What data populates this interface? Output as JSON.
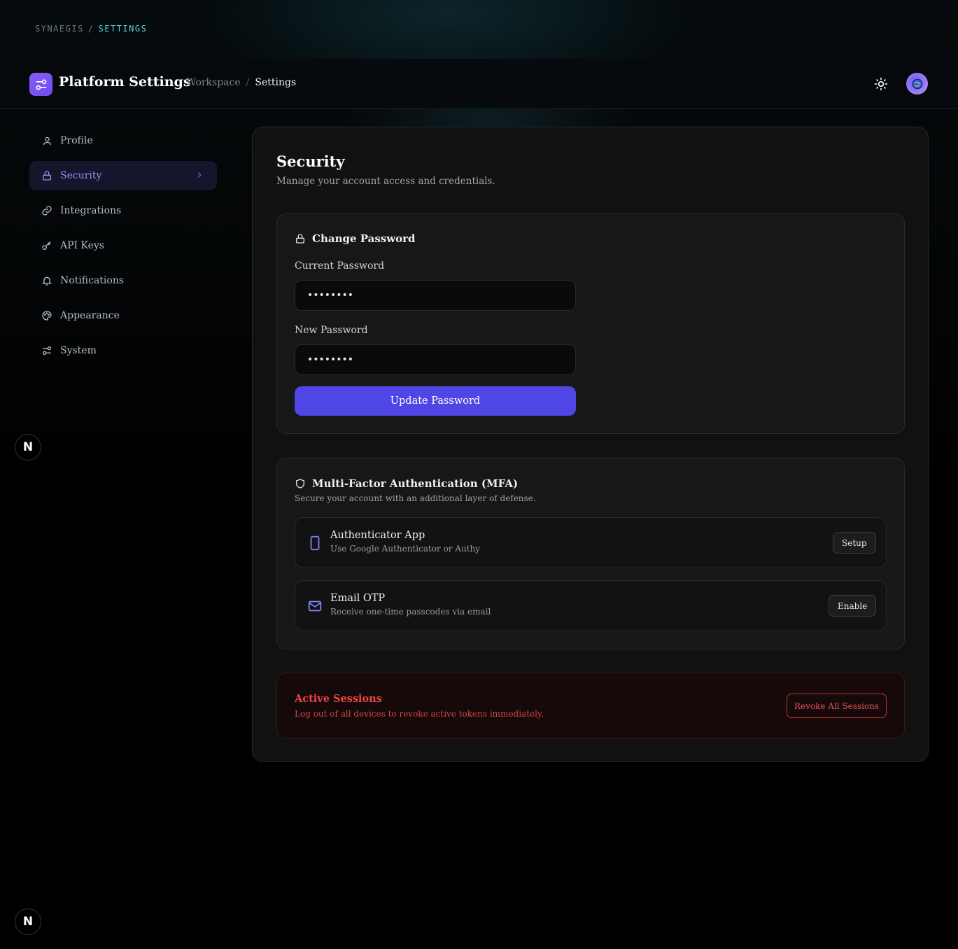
{
  "top_breadcrumb": {
    "root": "SYNAEGIS",
    "separator": "/",
    "current": "SETTINGS"
  },
  "header": {
    "title": "Platform Settings",
    "breadcrumb": {
      "parent": "Workspace",
      "separator": "/",
      "current": "Settings"
    },
    "theme_icon": "sun-icon",
    "avatar_icon": "globe-avatar"
  },
  "sidebar": {
    "items": [
      {
        "label": "Profile",
        "icon": "user-icon"
      },
      {
        "label": "Security",
        "icon": "lock-icon",
        "active": true
      },
      {
        "label": "Integrations",
        "icon": "link-icon"
      },
      {
        "label": "API Keys",
        "icon": "key-icon"
      },
      {
        "label": "Notifications",
        "icon": "bell-icon"
      },
      {
        "label": "Appearance",
        "icon": "palette-icon"
      },
      {
        "label": "System",
        "icon": "sliders-icon"
      }
    ]
  },
  "badge": {
    "letter": "N"
  },
  "page": {
    "title": "Security",
    "subtitle": "Manage your account access and credentials."
  },
  "change_password": {
    "title": "Change Password",
    "current_label": "Current Password",
    "current_value": "••••••••",
    "new_label": "New Password",
    "new_value": "••••••••",
    "submit_label": "Update Password"
  },
  "mfa": {
    "title": "Multi-Factor Authentication (MFA)",
    "subtitle": "Secure your account with an additional layer of defense.",
    "methods": [
      {
        "title": "Authenticator App",
        "desc": "Use Google Authenticator or Authy",
        "action": "Setup",
        "icon": "smartphone-icon"
      },
      {
        "title": "Email OTP",
        "desc": "Receive one-time passcodes via email",
        "action": "Enable",
        "icon": "mail-icon"
      }
    ]
  },
  "sessions": {
    "title": "Active Sessions",
    "desc": "Log out of all devices to revoke active tokens immediately.",
    "action": "Revoke All Sessions"
  },
  "colors": {
    "accent": "#4f46e5",
    "active_nav": "#8f95f5",
    "danger": "#ef4444",
    "breadcrumb_accent": "#5fd4e0"
  }
}
